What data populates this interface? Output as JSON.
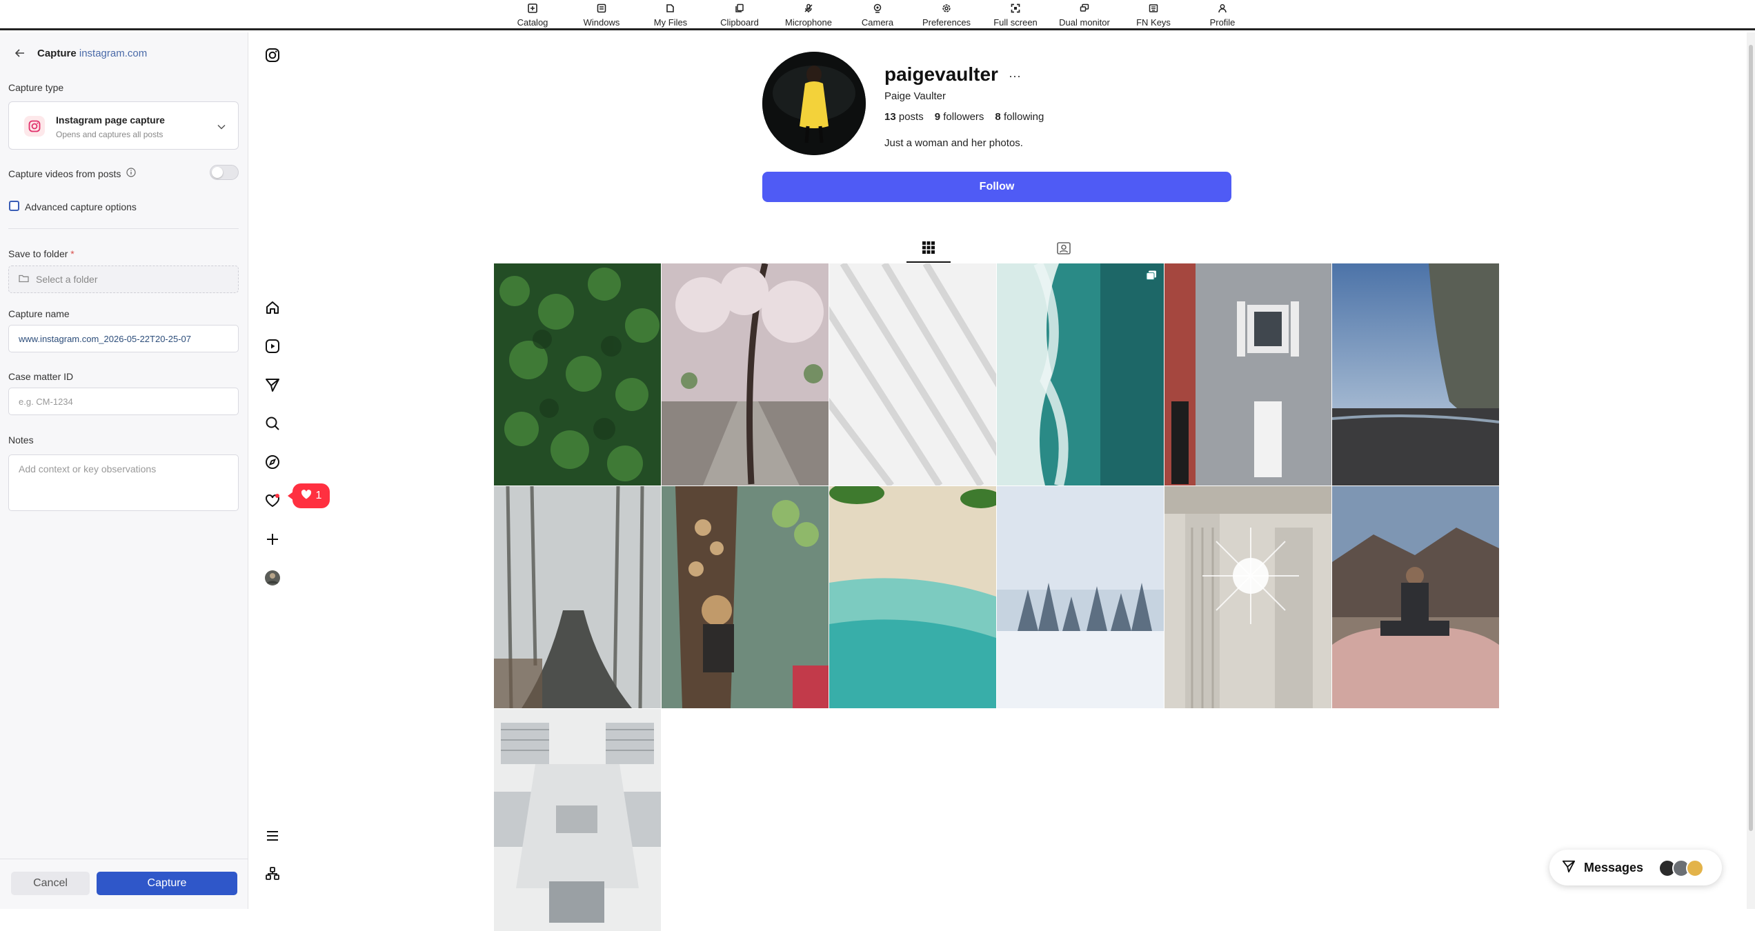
{
  "topbar": {
    "items": [
      {
        "label": "Catalog",
        "icon": "catalog-icon"
      },
      {
        "label": "Windows",
        "icon": "windows-icon"
      },
      {
        "label": "My Files",
        "icon": "folder-icon"
      },
      {
        "label": "Clipboard",
        "icon": "clipboard-icon"
      },
      {
        "label": "Microphone",
        "icon": "microphone-off-icon"
      },
      {
        "label": "Camera",
        "icon": "camera-icon"
      },
      {
        "label": "Preferences",
        "icon": "gear-icon"
      },
      {
        "label": "Full screen",
        "icon": "fullscreen-icon"
      },
      {
        "label": "Dual monitor",
        "icon": "dual-monitor-icon"
      },
      {
        "label": "FN Keys",
        "icon": "keyboard-icon"
      },
      {
        "label": "Profile",
        "icon": "user-icon"
      }
    ]
  },
  "capture_panel": {
    "title_prefix": "Capture",
    "title_host": "instagram.com",
    "capture_type_label": "Capture type",
    "capture_type_title": "Instagram page capture",
    "capture_type_subtitle": "Opens and captures all posts",
    "videos_label": "Capture videos from posts",
    "videos_enabled": false,
    "advanced_label": "Advanced capture options",
    "advanced_checked": false,
    "folder_label": "Save to folder",
    "folder_required_mark": "*",
    "folder_placeholder": "Select a folder",
    "name_label": "Capture name",
    "name_value": "www.instagram.com_2026-05-22T20-25-07",
    "case_label": "Case matter ID",
    "case_placeholder": "e.g. CM-1234",
    "notes_label": "Notes",
    "notes_placeholder": "Add context or key observations",
    "cancel_label": "Cancel",
    "capture_label": "Capture"
  },
  "ig_nav": {
    "icons": [
      "instagram-logo-icon",
      "home-icon",
      "reels-icon",
      "messages-icon",
      "search-icon",
      "explore-icon",
      "notifications-icon",
      "create-icon",
      "profile-avatar-icon",
      "more-menu-icon",
      "also-from-meta-icon"
    ],
    "notification_count": "1"
  },
  "profile": {
    "username": "paigevaulter",
    "more": "···",
    "full_name": "Paige Vaulter",
    "posts_count": "13",
    "posts_label": "posts",
    "followers_count": "9",
    "followers_label": "followers",
    "following_count": "8",
    "following_label": "following",
    "bio": "Just a woman and her photos.",
    "follow_label": "Follow",
    "tabs": [
      "posts-grid-tab",
      "tagged-tab"
    ],
    "active_tab": "posts-grid-tab"
  },
  "posts": [
    {
      "subject": "pine forest aerial",
      "colors": [
        "#1f4a22",
        "#3f7a36",
        "#2a5a2c"
      ]
    },
    {
      "subject": "cherry blossom path",
      "colors": [
        "#d8c8cc",
        "#8a7a78",
        "#b9a9ae"
      ]
    },
    {
      "subject": "white architecture lines",
      "colors": [
        "#f4f4f4",
        "#dcdcdc",
        "#eaeaea"
      ]
    },
    {
      "subject": "ocean waves aerial",
      "colors": [
        "#2f8f8a",
        "#cfe3e0",
        "#1e6a6a"
      ],
      "carousel": true
    },
    {
      "subject": "brick and grey townhouse",
      "colors": [
        "#a34a44",
        "#9b9fa4",
        "#bfc2c6"
      ]
    },
    {
      "subject": "cliffs at dusk beach",
      "colors": [
        "#6f8fb8",
        "#4e4e4e",
        "#d8a27a"
      ]
    },
    {
      "subject": "foggy forest road",
      "colors": [
        "#cfd3d4",
        "#7a7b78",
        "#a9aca9"
      ]
    },
    {
      "subject": "floating market boat",
      "colors": [
        "#6e8a7c",
        "#c9a77a",
        "#3f4a3e"
      ]
    },
    {
      "subject": "tropical beach aerial",
      "colors": [
        "#e6dcc4",
        "#3fb5b0",
        "#84cfc4"
      ]
    },
    {
      "subject": "snowy pine trees",
      "colors": [
        "#e7edf3",
        "#9fb1c4",
        "#f4f6f9"
      ]
    },
    {
      "subject": "classical columns sun flare",
      "colors": [
        "#d8d4cc",
        "#a8a49c",
        "#f2efe8"
      ]
    },
    {
      "subject": "man on pink car",
      "colors": [
        "#8a6a5a",
        "#caa39a",
        "#3b3a3c"
      ]
    },
    {
      "subject": "white library interior",
      "colors": [
        "#e8e9ea",
        "#aeb2b5",
        "#f6f7f7"
      ]
    }
  ],
  "messages": {
    "label": "Messages",
    "avatar_colors": [
      "#2b2b2b",
      "#6b6f74",
      "#e3b34a"
    ]
  },
  "accent_colors": {
    "follow": "#4f5bf5",
    "capture": "#2f57c9",
    "notification": "#ff3040"
  }
}
